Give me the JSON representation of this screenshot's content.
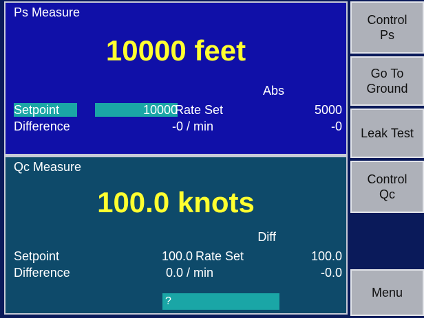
{
  "ps_panel": {
    "title": "Ps Measure",
    "reading": "10000 feet",
    "mode": "Abs",
    "setpoint_label": "Setpoint",
    "setpoint_value": "10000",
    "rate_set_label": "Rate Set",
    "rate_set_value": "5000",
    "difference_label": "Difference",
    "rate_value": "-0 / min",
    "difference_value": "-0"
  },
  "qc_panel": {
    "title": "Qc Measure",
    "reading": "100.0 knots",
    "mode": "Diff",
    "setpoint_label": "Setpoint",
    "setpoint_value": "100.0",
    "rate_set_label": "Rate Set",
    "rate_set_value": "100.0",
    "difference_label": "Difference",
    "rate_value": "0.0 / min",
    "difference_value": "-0.0",
    "entry_value": "?"
  },
  "softkeys": {
    "control_ps": "Control\nPs",
    "go_to_ground": "Go To\nGround",
    "leak_test": "Leak Test",
    "control_qc": "Control\nQc",
    "menu": "Menu"
  },
  "colors": {
    "ps_background": "#1010a8",
    "qc_background": "#0e4a6a",
    "reading_yellow": "#ffff30",
    "highlight_teal": "#1aa6a6",
    "softkey_gray": "#aeb1b9"
  }
}
